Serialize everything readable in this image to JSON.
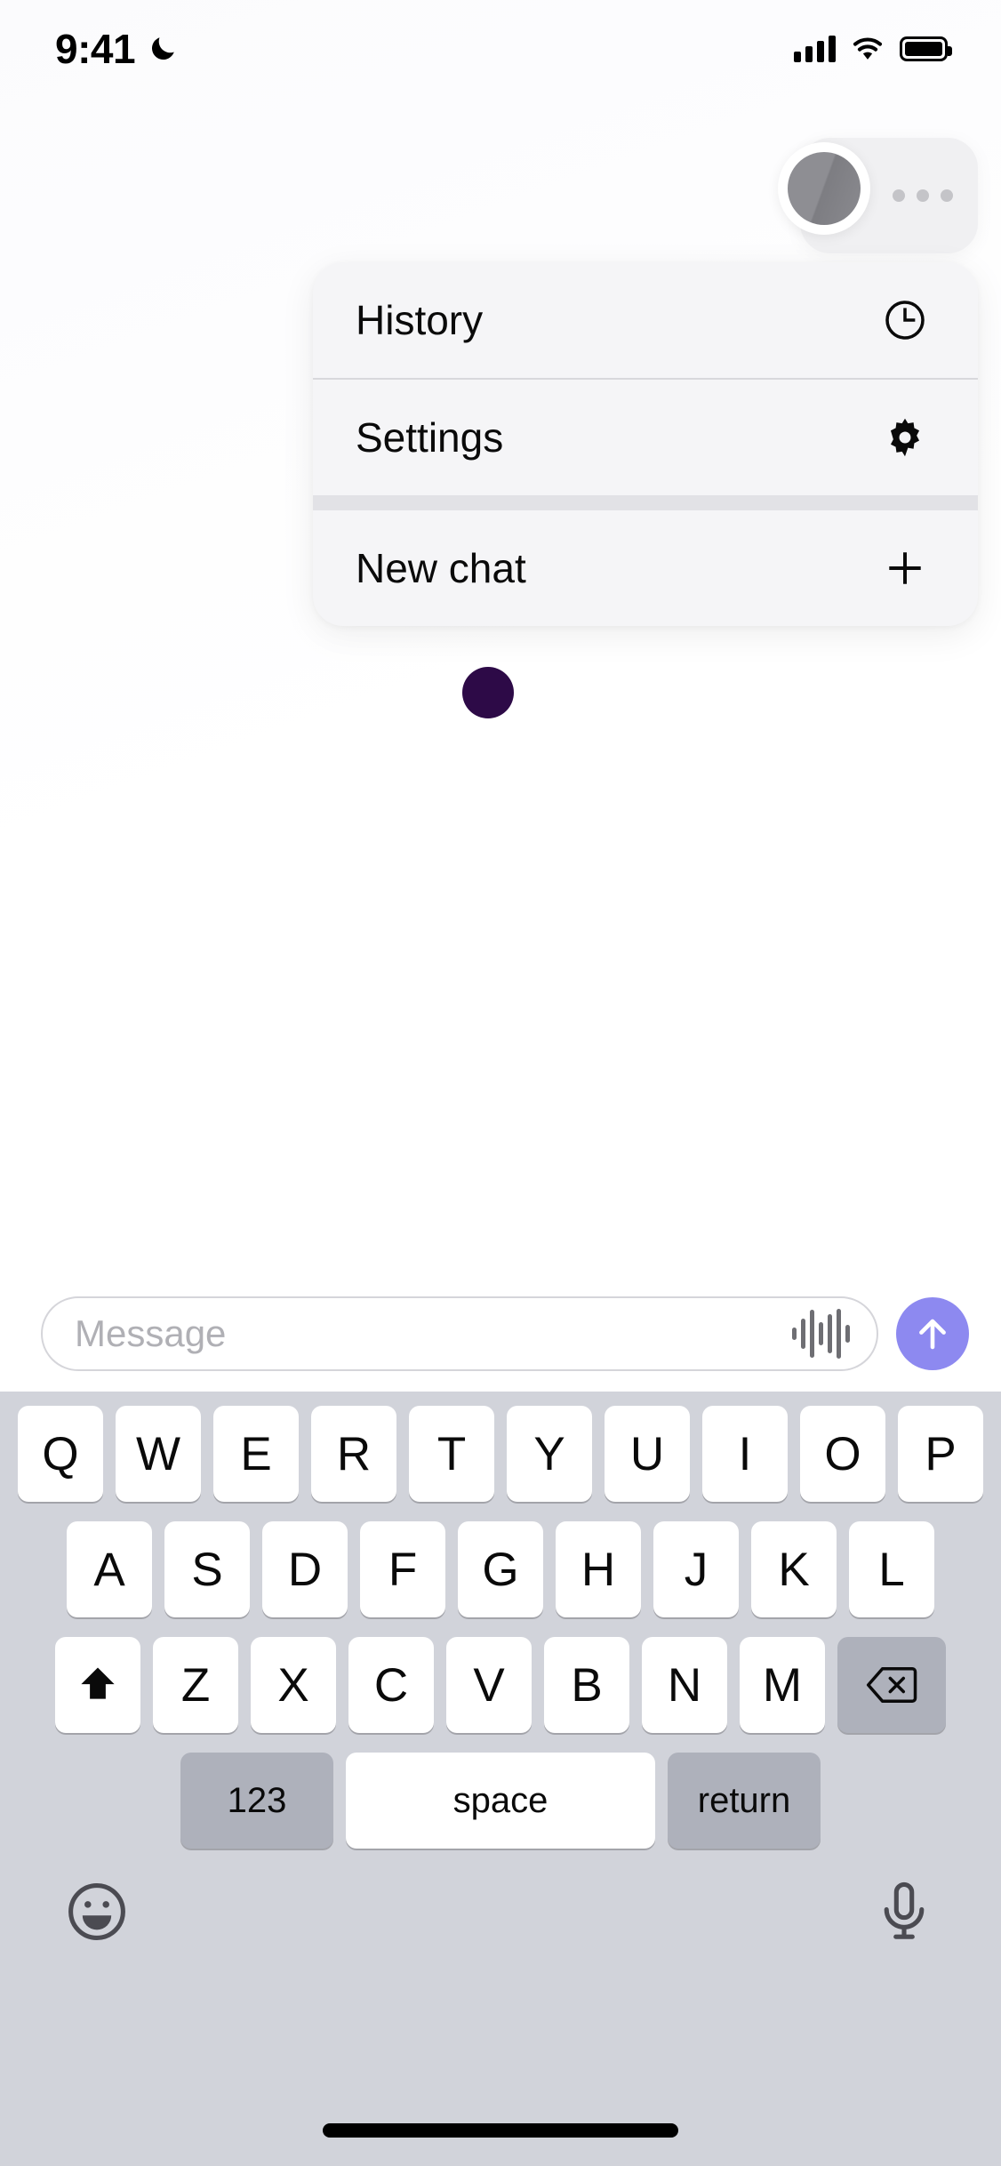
{
  "status_bar": {
    "time": "9:41",
    "dnd_icon": "crescent-moon-icon",
    "signal_icon": "cellular-signal-icon",
    "wifi_icon": "wifi-icon",
    "battery_icon": "battery-full-icon"
  },
  "profile": {
    "avatar_name": "user-avatar",
    "overflow_icon": "more-options-dots-icon"
  },
  "menu": {
    "items": [
      {
        "label": "History",
        "icon": "clock-icon"
      },
      {
        "label": "Settings",
        "icon": "gear-icon"
      },
      {
        "label": "New chat",
        "icon": "plus-icon"
      }
    ]
  },
  "indicator": {
    "dot_color": "#2d0a47",
    "name": "status-dot"
  },
  "composer": {
    "placeholder": "Message",
    "value": "",
    "voice_icon": "waveform-icon",
    "send_icon": "arrow-up-icon",
    "send_color": "#8d89f0"
  },
  "keyboard": {
    "row1": [
      "Q",
      "W",
      "E",
      "R",
      "T",
      "Y",
      "U",
      "I",
      "O",
      "P"
    ],
    "row2": [
      "A",
      "S",
      "D",
      "F",
      "G",
      "H",
      "J",
      "K",
      "L"
    ],
    "row3": [
      "Z",
      "X",
      "C",
      "V",
      "B",
      "N",
      "M"
    ],
    "shift_icon": "shift-up-arrow-icon",
    "backspace_icon": "backspace-delete-icon",
    "numbers_label": "123",
    "space_label": "space",
    "return_label": "return",
    "emoji_icon": "smiley-face-icon",
    "dictation_icon": "microphone-icon"
  }
}
